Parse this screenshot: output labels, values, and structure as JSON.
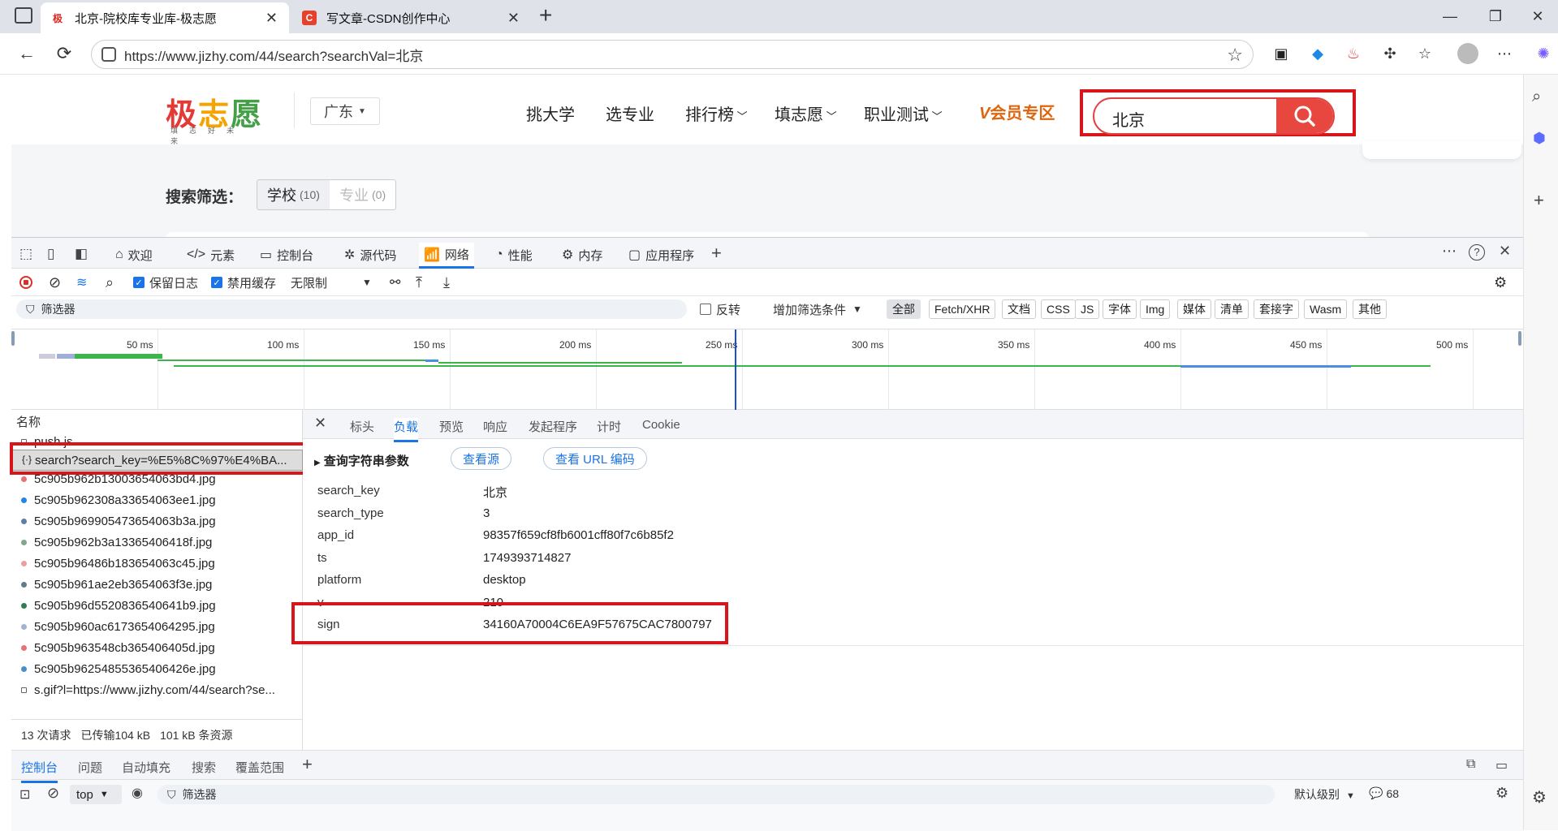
{
  "browser": {
    "tabs": [
      {
        "favicon": "极",
        "title": "北京-院校库专业库-极志愿",
        "close": "✕"
      },
      {
        "favicon": "C",
        "title": "写文章-CSDN创作中心",
        "close": "✕"
      }
    ],
    "new_tab": "+",
    "url": "https://www.jizhy.com/44/search?searchVal=北京"
  },
  "site": {
    "logo": "极志愿",
    "logo_sub": "填志好未来",
    "province": "广东",
    "nav": [
      "挑大学",
      "选专业",
      "排行榜",
      "填志愿",
      "职业测试"
    ],
    "vip": "会员专区",
    "search_value": "北京",
    "filter_label": "搜索筛选：",
    "filter_school": "学校",
    "filter_school_count": "(10)",
    "filter_major": "专业",
    "filter_major_count": "(0)"
  },
  "devtools": {
    "tabs": [
      "欢迎",
      "元素",
      "控制台",
      "源代码",
      "网络",
      "性能",
      "内存",
      "应用程序"
    ],
    "toolbar": {
      "preserve_log": "保留日志",
      "disable_cache": "禁用缓存",
      "throttle": "无限制"
    },
    "filter": {
      "placeholder": "筛选器",
      "invert": "反转",
      "more_filters": "增加筛选条件"
    },
    "filter_types": [
      "全部",
      "Fetch/XHR",
      "文档",
      "CSS",
      "JS",
      "字体",
      "Img",
      "媒体",
      "清单",
      "套接字",
      "Wasm",
      "其他"
    ],
    "timeline_labels": [
      "50 ms",
      "100 ms",
      "150 ms",
      "200 ms",
      "250 ms",
      "300 ms",
      "350 ms",
      "400 ms",
      "450 ms",
      "500 ms"
    ],
    "name_header": "名称",
    "requests": [
      "push.js",
      "search?search_key=%E5%8C%97%E4%BA...",
      "5c905b962b13003654063bd4.jpg",
      "5c905b962308a33654063ee1.jpg",
      "5c905b969905473654063b3a.jpg",
      "5c905b962b3a13365406418f.jpg",
      "5c905b96486b183654063c45.jpg",
      "5c905b961ae2eb3654063f3e.jpg",
      "5c905b96d5520836540641b9.jpg",
      "5c905b960ac6173654064295.jpg",
      "5c905b963548cb365406405d.jpg",
      "5c905b96254855365406426e.jpg",
      "s.gif?l=https://www.jizhy.com/44/search?se..."
    ],
    "summary": {
      "requests": "13 次请求",
      "transferred": "已传输104 kB",
      "resources": "101 kB 条资源"
    },
    "detail_tabs": [
      "标头",
      "负载",
      "预览",
      "响应",
      "发起程序",
      "计时",
      "Cookie"
    ],
    "query_title": "查询字符串参数",
    "view_source": "查看源",
    "view_url_encoded": "查看 URL 编码",
    "params": [
      {
        "key": "search_key",
        "value": "北京"
      },
      {
        "key": "search_type",
        "value": "3"
      },
      {
        "key": "app_id",
        "value": "98357f659cf8fb6001cff80f7c6b85f2"
      },
      {
        "key": "ts",
        "value": "1749393714827"
      },
      {
        "key": "platform",
        "value": "desktop"
      },
      {
        "key": "v",
        "value": "210"
      },
      {
        "key": "sign",
        "value": "34160A70004C6EA9F57675CAC7800797"
      }
    ],
    "drawer_tabs": [
      "控制台",
      "问题",
      "自动填充",
      "搜索",
      "覆盖范围"
    ],
    "console": {
      "context": "top",
      "filter_placeholder": "筛选器",
      "level": "默认级别",
      "issues": "68"
    }
  }
}
